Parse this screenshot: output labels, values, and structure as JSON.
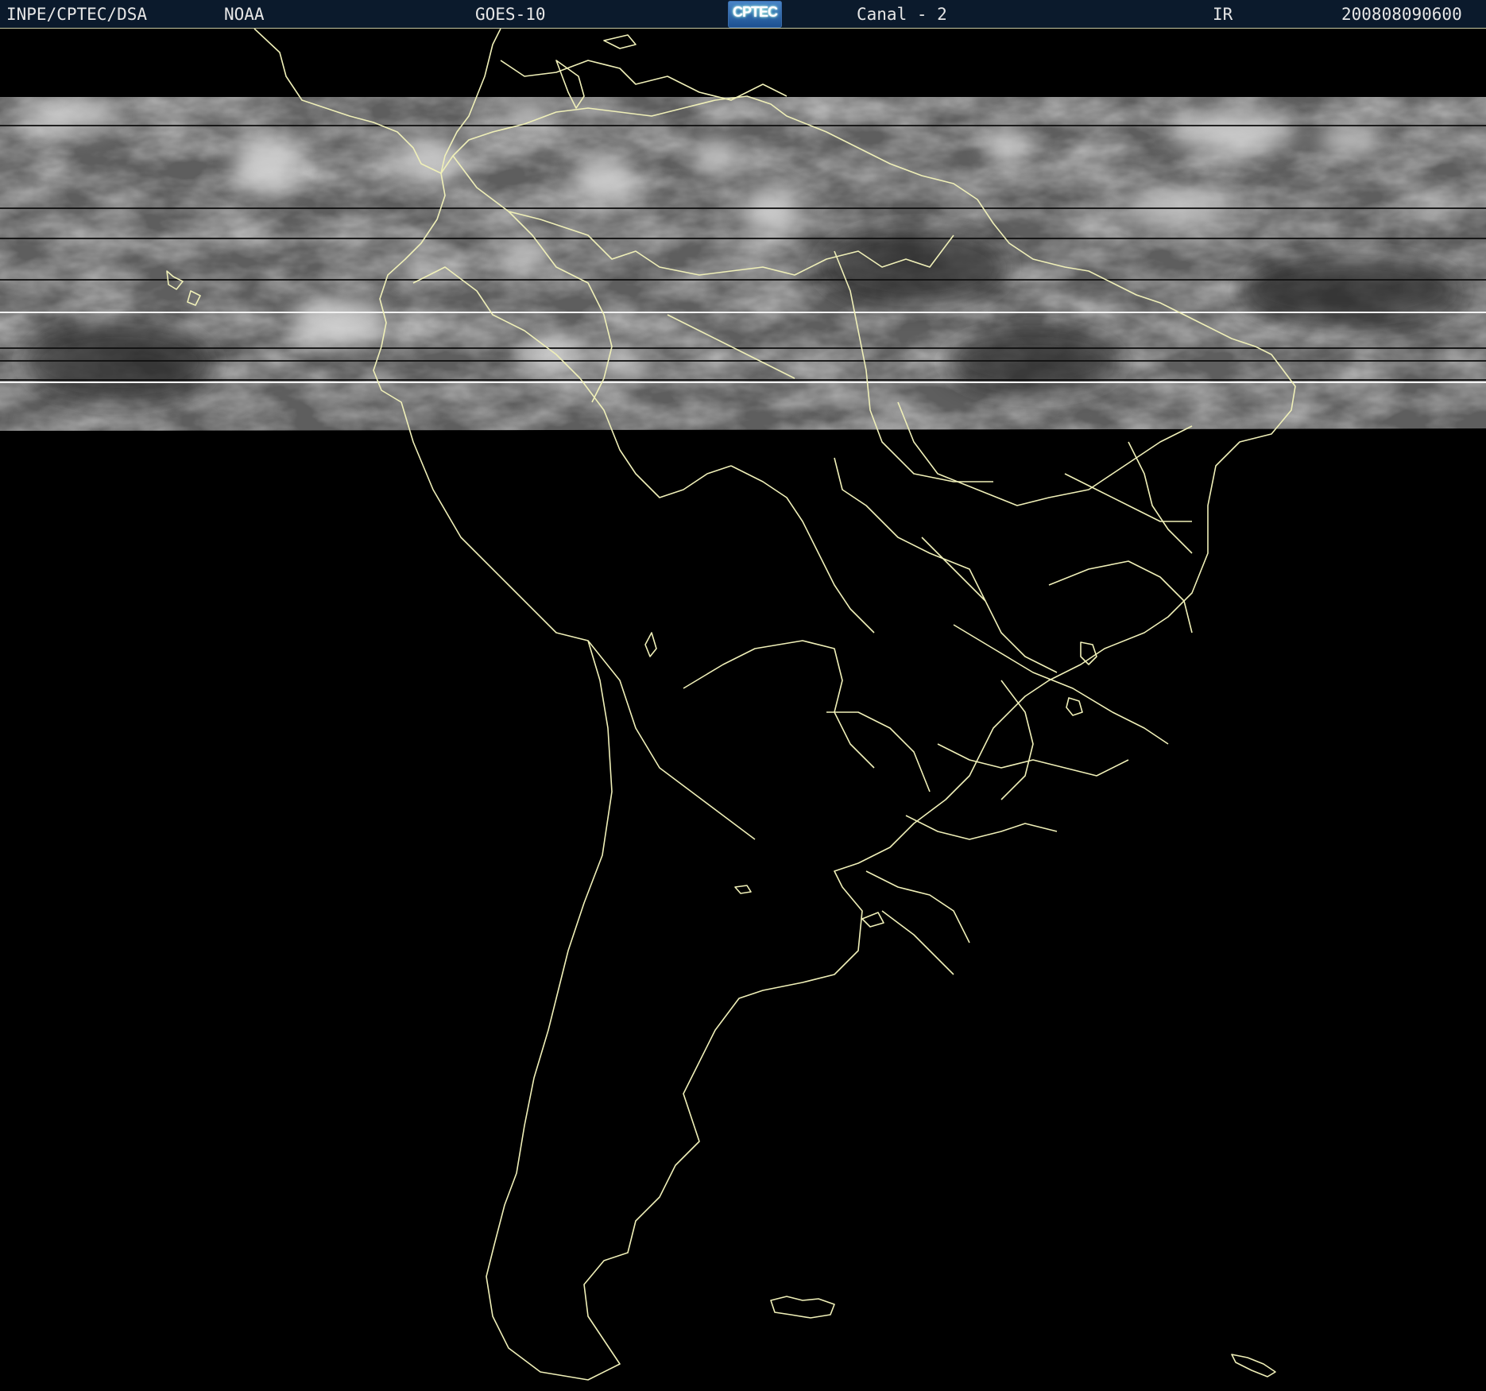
{
  "header": {
    "source": "INPE/CPTEC/DSA",
    "agency": "NOAA",
    "satellite": "GOES-10",
    "logo_text": "CPTEC",
    "channel": "Canal - 2",
    "band": "IR",
    "timestamp": "200808090600"
  },
  "colors": {
    "background": "#000000",
    "header_bg": "#0b1a2c",
    "coastline": "#f0f0b8",
    "header_text": "#e6e6e6"
  },
  "map": {
    "icon": "satellite-imagery",
    "coverage": "cloud-band-strip"
  }
}
